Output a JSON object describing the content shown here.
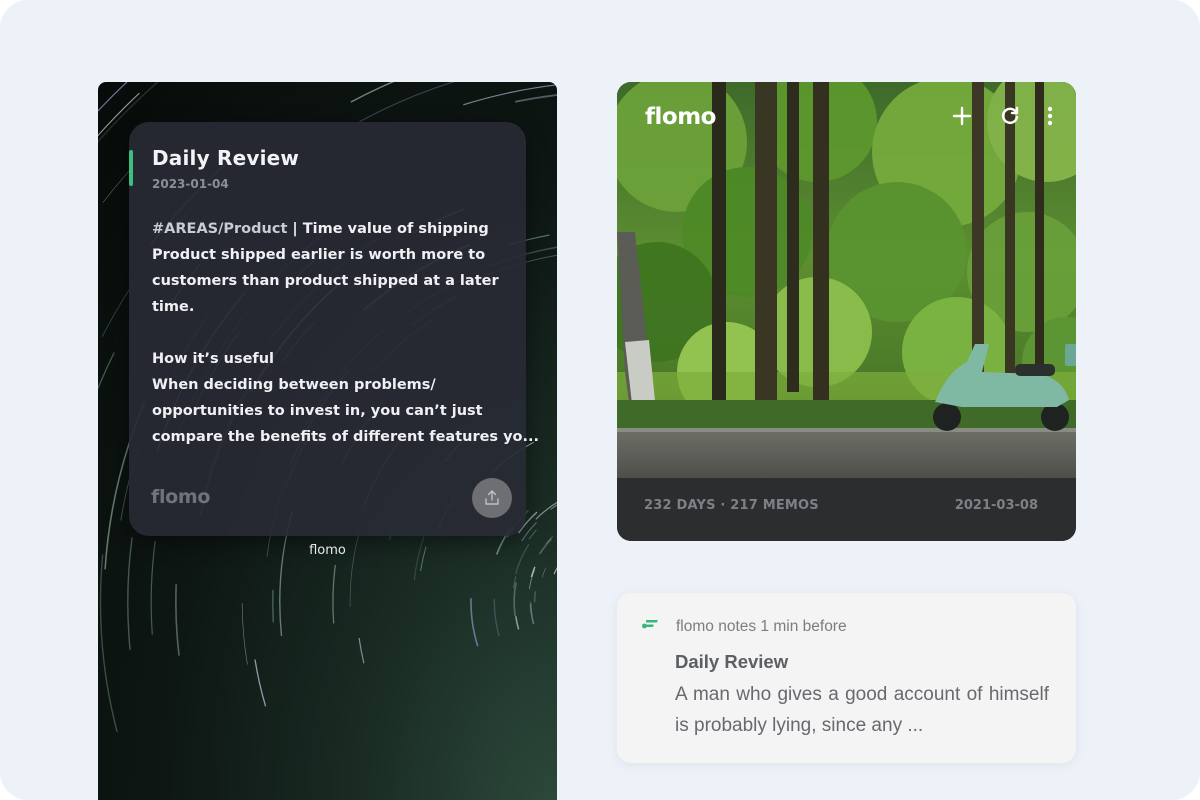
{
  "left_widget": {
    "memo": {
      "title": "Daily Review",
      "date": "2023-01-04",
      "tag": "#AREAS/Product",
      "line1_rest": " | Time value of shipping",
      "lines": [
        "Product shipped earlier is worth more to",
        "customers than product shipped at a later",
        "time."
      ],
      "lines2": [
        "How it’s useful",
        "When deciding between problems/",
        "opportunities to invest in, you can’t just",
        "compare the benefits of different features yo..."
      ],
      "logo": "flomo",
      "share_icon": "share-upload-icon"
    },
    "label": "flomo"
  },
  "photo_widget": {
    "logo": "flomo",
    "icons": [
      "plus-icon",
      "refresh-icon",
      "more-vertical-icon"
    ],
    "stats": "232 DAYS · 217 MEMOS",
    "date": "2021-03-08"
  },
  "notification": {
    "icon": "flomo-app-icon",
    "meta": "flomo notes 1 min before",
    "title": "Daily Review",
    "body": "A man who gives a good account of himself is probably lying, since any ..."
  },
  "colors": {
    "accent_green": "#3fbf7f",
    "page_bg": "#edf1f8"
  }
}
